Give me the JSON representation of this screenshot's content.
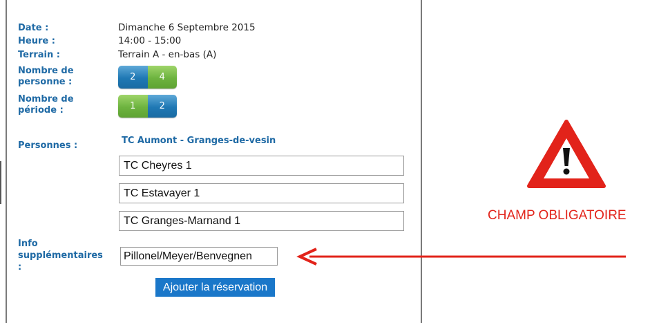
{
  "details": {
    "date_label": "Date :",
    "date_value": "Dimanche 6 Septembre 2015",
    "heure_label": "Heure :",
    "heure_value": "14:00 - 15:00",
    "terrain_label": "Terrain :",
    "terrain_value": "Terrain A - en-bas (A)",
    "nb_personne_label_1": "Nombre de",
    "nb_personne_label_2": "personne :",
    "nb_periode_label_1": "Nombre de",
    "nb_periode_label_2": "période :"
  },
  "personne_options": [
    "2",
    "4"
  ],
  "periode_options": [
    "1",
    "2"
  ],
  "personnes": {
    "label": "Personnes :",
    "team": "TC Aumont - Granges-de-vesin",
    "inputs": [
      "TC Cheyres 1",
      "TC Estavayer 1",
      "TC Granges-Marnand 1"
    ]
  },
  "info": {
    "label_1": "Info",
    "label_2": "supplémentaires",
    "label_3": ":",
    "value": "Pillonel/Meyer/Benvegnen"
  },
  "submit_label": "Ajouter la réservation",
  "warning": {
    "text": "CHAMP OBLIGATOIRE",
    "icon": "warning-triangle-icon",
    "arrow_icon": "arrow-left-icon",
    "color": "#e2231a"
  }
}
